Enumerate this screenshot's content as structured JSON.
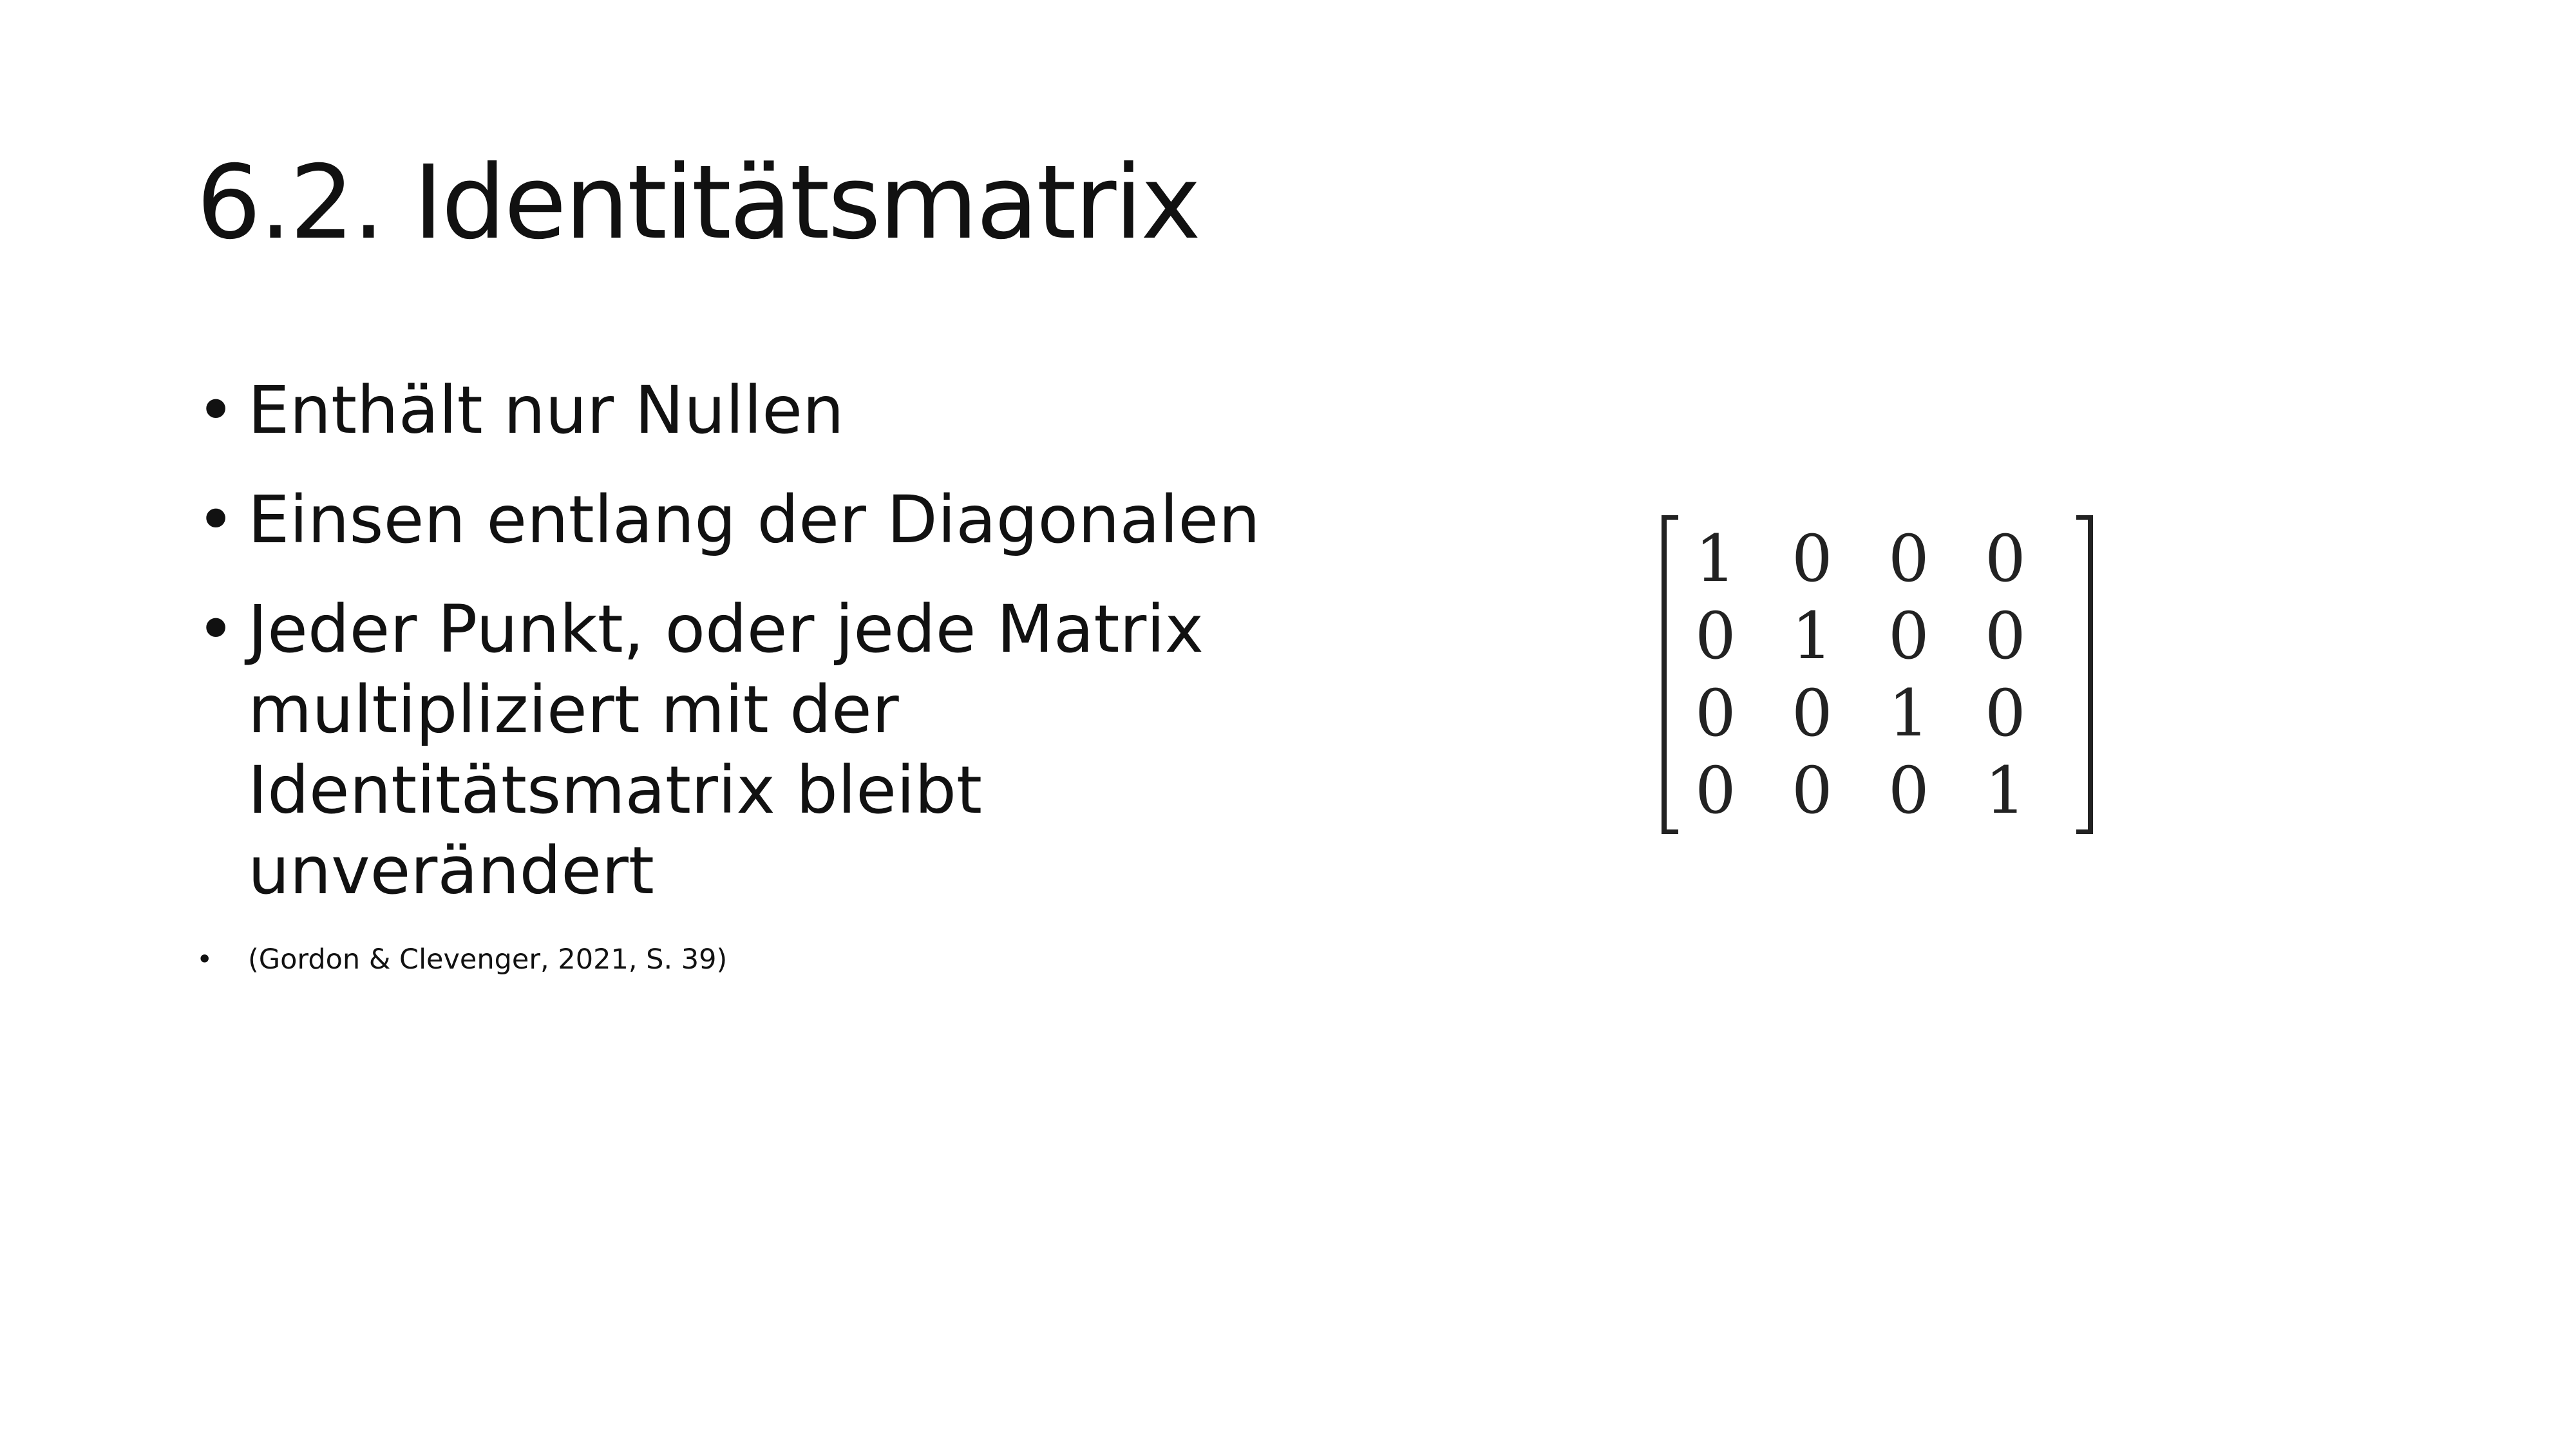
{
  "slide": {
    "title": "6.2. Identitätsmatrix",
    "bullets": [
      {
        "text": "Enthält nur Nullen"
      },
      {
        "text": "Einsen entlang der Diagonalen"
      },
      {
        "text": "Jeder Punkt, oder jede Matrix multipliziert mit der Identitätsmatrix bleibt unverändert"
      },
      {
        "text": "(Gordon & Clevenger, 2021, S. 39)"
      }
    ],
    "bullet_symbol": "•",
    "matrix": [
      [
        "1",
        "0",
        "0",
        "0"
      ],
      [
        "0",
        "1",
        "0",
        "0"
      ],
      [
        "0",
        "0",
        "1",
        "0"
      ],
      [
        "0",
        "0",
        "0",
        "1"
      ]
    ]
  }
}
